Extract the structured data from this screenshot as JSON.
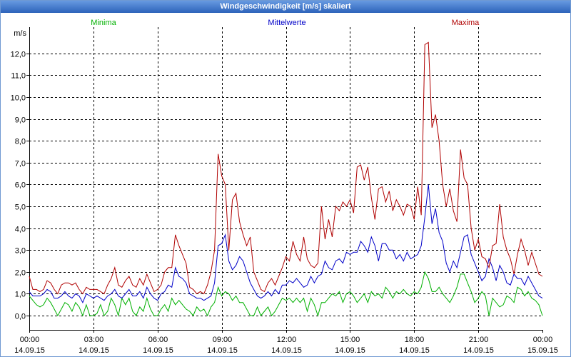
{
  "colors": {
    "title_bar": "#3a6ec4",
    "title_text": "#ffffff",
    "grid": "#000000"
  },
  "chart_data": {
    "type": "line",
    "title": "Windgeschwindigkeit [m/s] skaliert",
    "ylabel": "m/s",
    "ylim": [
      -0.65,
      13.2
    ],
    "grid": true,
    "legend": "top",
    "y_ticks": [
      {
        "value": 0,
        "label": "0,0"
      },
      {
        "value": 1,
        "label": "1,0"
      },
      {
        "value": 2,
        "label": "2,0"
      },
      {
        "value": 3,
        "label": "3,0"
      },
      {
        "value": 4,
        "label": "4,0"
      },
      {
        "value": 5,
        "label": "5,0"
      },
      {
        "value": 6,
        "label": "6,0"
      },
      {
        "value": 7,
        "label": "7,0"
      },
      {
        "value": 8,
        "label": "8,0"
      },
      {
        "value": 9,
        "label": "9,0"
      },
      {
        "value": 10,
        "label": "10,0"
      },
      {
        "value": 11,
        "label": "11,0"
      },
      {
        "value": 12,
        "label": "12,0"
      }
    ],
    "x_ticks": [
      {
        "time": "00:00",
        "date": "14.09.15"
      },
      {
        "time": "03:00",
        "date": "14.09.15"
      },
      {
        "time": "06:00",
        "date": "14.09.15"
      },
      {
        "time": "09:00",
        "date": "14.09.15"
      },
      {
        "time": "12:00",
        "date": "14.09.15"
      },
      {
        "time": "15:00",
        "date": "14.09.15"
      },
      {
        "time": "18:00",
        "date": "14.09.15"
      },
      {
        "time": "21:00",
        "date": "14.09.15"
      },
      {
        "time": "00:00",
        "date": "15.09.15"
      }
    ],
    "x": [
      "14.09.15 00:00",
      "14.09.15 00:10",
      "14.09.15 00:20",
      "14.09.15 00:30",
      "14.09.15 00:40",
      "14.09.15 00:50",
      "14.09.15 01:00",
      "14.09.15 01:10",
      "14.09.15 01:20",
      "14.09.15 01:30",
      "14.09.15 01:40",
      "14.09.15 01:50",
      "14.09.15 02:00",
      "14.09.15 02:10",
      "14.09.15 02:20",
      "14.09.15 02:30",
      "14.09.15 02:40",
      "14.09.15 02:50",
      "14.09.15 03:00",
      "14.09.15 03:10",
      "14.09.15 03:20",
      "14.09.15 03:30",
      "14.09.15 03:40",
      "14.09.15 03:50",
      "14.09.15 04:00",
      "14.09.15 04:10",
      "14.09.15 04:20",
      "14.09.15 04:30",
      "14.09.15 04:40",
      "14.09.15 04:50",
      "14.09.15 05:00",
      "14.09.15 05:10",
      "14.09.15 05:20",
      "14.09.15 05:30",
      "14.09.15 05:40",
      "14.09.15 05:50",
      "14.09.15 06:00",
      "14.09.15 06:10",
      "14.09.15 06:20",
      "14.09.15 06:30",
      "14.09.15 06:40",
      "14.09.15 06:50",
      "14.09.15 07:00",
      "14.09.15 07:10",
      "14.09.15 07:20",
      "14.09.15 07:30",
      "14.09.15 07:40",
      "14.09.15 07:50",
      "14.09.15 08:00",
      "14.09.15 08:10",
      "14.09.15 08:20",
      "14.09.15 08:30",
      "14.09.15 08:40",
      "14.09.15 08:50",
      "14.09.15 09:00",
      "14.09.15 09:10",
      "14.09.15 09:20",
      "14.09.15 09:30",
      "14.09.15 09:40",
      "14.09.15 09:50",
      "14.09.15 10:00",
      "14.09.15 10:10",
      "14.09.15 10:20",
      "14.09.15 10:30",
      "14.09.15 10:40",
      "14.09.15 10:50",
      "14.09.15 11:00",
      "14.09.15 11:10",
      "14.09.15 11:20",
      "14.09.15 11:30",
      "14.09.15 11:40",
      "14.09.15 11:50",
      "14.09.15 12:00",
      "14.09.15 12:10",
      "14.09.15 12:20",
      "14.09.15 12:30",
      "14.09.15 12:40",
      "14.09.15 12:50",
      "14.09.15 13:00",
      "14.09.15 13:10",
      "14.09.15 13:20",
      "14.09.15 13:30",
      "14.09.15 13:40",
      "14.09.15 13:50",
      "14.09.15 14:00",
      "14.09.15 14:10",
      "14.09.15 14:20",
      "14.09.15 14:30",
      "14.09.15 14:40",
      "14.09.15 14:50",
      "14.09.15 15:00",
      "14.09.15 15:10",
      "14.09.15 15:20",
      "14.09.15 15:30",
      "14.09.15 15:40",
      "14.09.15 15:50",
      "14.09.15 16:00",
      "14.09.15 16:10",
      "14.09.15 16:20",
      "14.09.15 16:30",
      "14.09.15 16:40",
      "14.09.15 16:50",
      "14.09.15 17:00",
      "14.09.15 17:10",
      "14.09.15 17:20",
      "14.09.15 17:30",
      "14.09.15 17:40",
      "14.09.15 17:50",
      "14.09.15 18:00",
      "14.09.15 18:10",
      "14.09.15 18:20",
      "14.09.15 18:30",
      "14.09.15 18:40",
      "14.09.15 18:50",
      "14.09.15 19:00",
      "14.09.15 19:10",
      "14.09.15 19:20",
      "14.09.15 19:30",
      "14.09.15 19:40",
      "14.09.15 19:50",
      "14.09.15 20:00",
      "14.09.15 20:10",
      "14.09.15 20:20",
      "14.09.15 20:30",
      "14.09.15 20:40",
      "14.09.15 20:50",
      "14.09.15 21:00",
      "14.09.15 21:10",
      "14.09.15 21:20",
      "14.09.15 21:30",
      "14.09.15 21:40",
      "14.09.15 21:50",
      "14.09.15 22:00",
      "14.09.15 22:10",
      "14.09.15 22:20",
      "14.09.15 22:30",
      "14.09.15 22:40",
      "14.09.15 22:50",
      "14.09.15 23:00",
      "14.09.15 23:10",
      "14.09.15 23:20",
      "14.09.15 23:30",
      "14.09.15 23:40",
      "14.09.15 23:50",
      "15.09.15 00:00"
    ],
    "series": [
      {
        "name": "Minima",
        "color": "#00b000",
        "values": [
          0.9,
          0.7,
          0.5,
          0.4,
          0.5,
          0.8,
          0.6,
          0.3,
          0.0,
          0.3,
          0.6,
          0.5,
          0.2,
          0.6,
          0.4,
          0.0,
          0.5,
          0.0,
          0.0,
          0.1,
          0.5,
          0.0,
          0.2,
          0.8,
          0.5,
          0.0,
          0.8,
          0.5,
          0.8,
          0.2,
          0.0,
          0.4,
          0.2,
          0.8,
          0.3,
          0.0,
          0.0,
          0.3,
          0.5,
          0.2,
          0.8,
          0.5,
          0.7,
          0.5,
          0.3,
          0.2,
          0.0,
          0.4,
          0.2,
          0.3,
          0.0,
          0.4,
          0.6,
          1.3,
          0.9,
          1.1,
          1.0,
          0.7,
          0.9,
          0.6,
          0.6,
          0.3,
          0.0,
          0.0,
          0.4,
          0.0,
          0.2,
          0.4,
          0.0,
          0.2,
          0.5,
          0.8,
          0.7,
          0.8,
          0.6,
          0.8,
          0.6,
          0.8,
          0.2,
          0.8,
          0.5,
          0.0,
          0.6,
          0.6,
          0.8,
          1.0,
          0.9,
          1.1,
          0.6,
          1.0,
          1.1,
          0.9,
          0.6,
          0.8,
          1.0,
          0.6,
          1.1,
          0.9,
          1.0,
          0.8,
          1.3,
          1.1,
          0.8,
          1.1,
          1.0,
          1.2,
          1.0,
          0.9,
          1.1,
          1.0,
          1.3,
          2.0,
          1.7,
          1.1,
          1.1,
          1.3,
          1.0,
          0.8,
          0.6,
          0.9,
          1.3,
          1.9,
          1.9,
          1.5,
          1.1,
          0.6,
          0.8,
          1.1,
          0.9,
          0.0,
          0.8,
          0.6,
          0.4,
          0.5,
          0.9,
          0.8,
          0.6,
          1.3,
          1.2,
          0.9,
          1.1,
          0.8,
          0.7,
          0.5,
          0.0
        ]
      },
      {
        "name": "Mittelwerte",
        "color": "#0000c8",
        "values": [
          1.1,
          0.9,
          0.9,
          0.9,
          1.0,
          1.2,
          1.1,
          0.8,
          0.8,
          0.9,
          1.1,
          0.9,
          0.8,
          1.0,
          0.9,
          0.6,
          1.0,
          0.9,
          0.8,
          0.9,
          0.8,
          0.7,
          0.9,
          1.0,
          1.2,
          0.9,
          0.8,
          1.0,
          1.2,
          0.9,
          0.9,
          1.1,
          0.8,
          1.3,
          1.0,
          0.8,
          0.7,
          1.0,
          1.1,
          1.4,
          1.3,
          2.2,
          1.8,
          1.7,
          1.5,
          1.0,
          0.9,
          0.8,
          0.8,
          0.7,
          0.8,
          0.9,
          1.5,
          3.2,
          3.3,
          3.7,
          2.5,
          2.1,
          2.3,
          2.7,
          2.5,
          2.0,
          1.5,
          1.2,
          0.9,
          0.8,
          0.9,
          1.1,
          0.9,
          1.2,
          1.0,
          1.4,
          1.4,
          1.6,
          1.5,
          1.7,
          1.5,
          1.3,
          1.4,
          1.8,
          1.5,
          1.8,
          1.9,
          2.5,
          2.2,
          2.1,
          2.5,
          2.6,
          2.4,
          2.9,
          2.8,
          2.9,
          2.9,
          3.4,
          3.2,
          2.9,
          3.6,
          3.2,
          2.5,
          3.3,
          3.3,
          3.0,
          3.0,
          2.6,
          2.8,
          2.5,
          2.9,
          2.6,
          2.7,
          2.8,
          3.2,
          4.5,
          6.0,
          4.2,
          4.9,
          3.8,
          3.4,
          2.4,
          2.0,
          2.5,
          2.2,
          2.9,
          3.6,
          3.7,
          2.8,
          2.4,
          2.0,
          1.6,
          1.8,
          2.6,
          2.2,
          1.6,
          2.3,
          2.0,
          1.5,
          1.4,
          1.9,
          1.7,
          1.7,
          1.4,
          1.8,
          1.5,
          1.2,
          0.9,
          0.8
        ]
      },
      {
        "name": "Maxima",
        "color": "#b00000",
        "values": [
          1.8,
          1.2,
          1.2,
          1.1,
          1.2,
          1.6,
          1.5,
          1.2,
          1.0,
          1.4,
          1.5,
          1.5,
          1.4,
          1.5,
          1.2,
          1.0,
          1.3,
          1.2,
          1.2,
          1.2,
          1.1,
          1.0,
          1.4,
          1.7,
          2.2,
          1.4,
          1.3,
          1.6,
          1.8,
          1.4,
          1.3,
          1.7,
          1.4,
          1.9,
          1.5,
          1.1,
          1.2,
          1.4,
          2.0,
          2.2,
          2.2,
          3.7,
          3.2,
          2.8,
          2.4,
          1.3,
          1.2,
          1.0,
          1.1,
          1.0,
          1.4,
          2.0,
          3.0,
          7.4,
          6.4,
          6.0,
          3.0,
          5.3,
          5.6,
          4.3,
          3.7,
          3.2,
          3.6,
          2.0,
          1.6,
          1.2,
          1.1,
          1.5,
          1.7,
          1.4,
          1.8,
          2.2,
          2.7,
          2.5,
          3.4,
          2.8,
          2.5,
          3.6,
          2.6,
          2.3,
          2.2,
          2.4,
          5.0,
          3.5,
          4.4,
          3.6,
          5.0,
          4.8,
          5.2,
          5.0,
          5.3,
          4.7,
          6.8,
          6.9,
          6.2,
          6.8,
          5.4,
          4.4,
          5.8,
          5.9,
          5.2,
          5.7,
          4.8,
          5.3,
          5.0,
          4.6,
          5.1,
          5.0,
          4.4,
          5.9,
          4.6,
          12.4,
          12.5,
          8.6,
          9.2,
          8.0,
          6.0,
          5.0,
          5.8,
          4.8,
          4.3,
          7.6,
          6.3,
          6.0,
          4.0,
          3.0,
          3.5,
          2.7,
          2.6,
          2.2,
          3.2,
          3.3,
          5.1,
          3.6,
          3.0,
          2.6,
          1.9,
          2.8,
          3.5,
          3.0,
          2.3,
          2.9,
          2.4,
          1.9,
          1.8
        ]
      }
    ]
  }
}
